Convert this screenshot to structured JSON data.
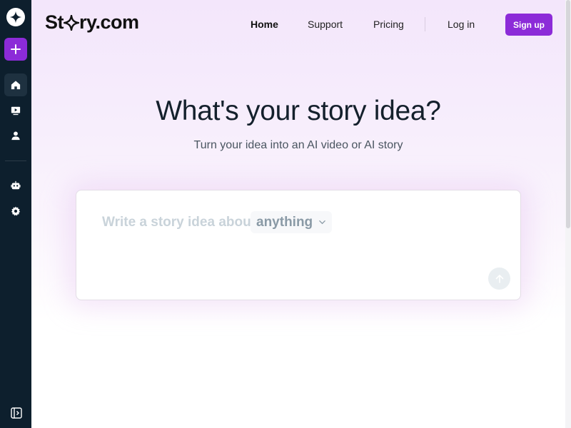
{
  "brand": {
    "name_pre": "St",
    "name_post": "ry.com"
  },
  "nav": {
    "home": "Home",
    "support": "Support",
    "pricing": "Pricing",
    "login": "Log in",
    "signup": "Sign up"
  },
  "hero": {
    "title": "What's your story idea?",
    "subtitle": "Turn your idea into an AI video or AI story"
  },
  "prompt": {
    "text": "Write a story idea about",
    "topic": "anything"
  },
  "sidebar": {
    "icons": [
      "logo-icon",
      "plus-icon",
      "home-icon",
      "video-icon",
      "user-icon",
      "robot-icon",
      "gear-icon",
      "sidebar-toggle-icon"
    ]
  },
  "colors": {
    "accent": "#8c2bd8",
    "sidebar_bg": "#0d1f2d",
    "heading": "#14202c"
  }
}
